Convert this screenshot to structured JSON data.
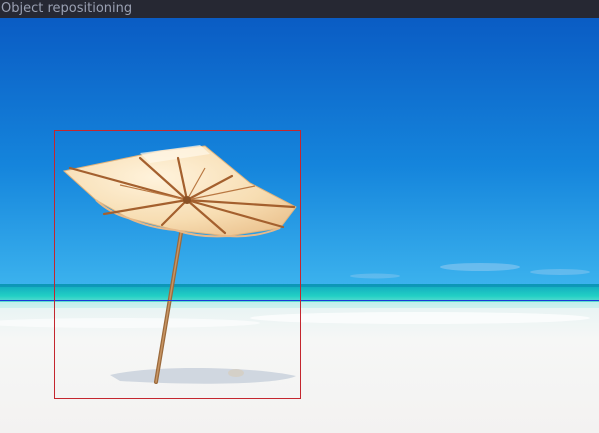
{
  "window": {
    "title": "Object repositioning"
  },
  "canvas": {
    "scene": "beach-umbrella-photo",
    "colors": {
      "sky_top": "#0a5cc4",
      "sky_horizon": "#1fa0e6",
      "sea": "#19c7bf",
      "sand": "#f4f4f2",
      "selection_box": "#c4262e",
      "horizon_guide": "#1a3bd6"
    }
  }
}
